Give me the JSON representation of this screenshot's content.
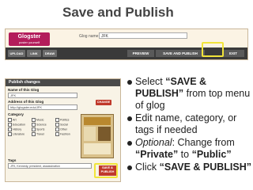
{
  "slide": {
    "title": "Save and Publish"
  },
  "glogster_top": {
    "logo_text": "Glogster",
    "logo_sub": "poster yourself",
    "glog_name_label": "Glog name:",
    "glog_name_value": "JFK",
    "buttons": {
      "upload": "UPLOAD",
      "link": "LINK",
      "draw": "DRAW"
    },
    "preview_label": "PREVIEW",
    "save_publish_label": "SAVE AND PUBLISH",
    "exit_label": "EXIT"
  },
  "publish_panel": {
    "header": "Publish changes",
    "name_label": "Name of this Glog",
    "name_value": "JFK",
    "address_label": "Address of this Glog",
    "address_value": "http://glogster.edu/JFK",
    "change_label": "CHANGE",
    "category_label": "Category",
    "categories": [
      "Art",
      "Education",
      "History",
      "Literature",
      "Music",
      "Science",
      "Sports",
      "Travel",
      "Politics",
      "Social",
      "Other",
      "Fashion"
    ],
    "tags_label": "Tags",
    "tags_value": "JFK, Kennedy, president, assassination",
    "save_btn_line1": "SAVE &",
    "save_btn_line2": "PUBLISH"
  },
  "bullets": [
    {
      "prefix": "Select ",
      "bold": "“SAVE & PUBLISH”",
      "suffix": " from top menu of glog"
    },
    {
      "text": "Edit name, category, or tags if needed"
    },
    {
      "italic": "Optional",
      "mid": ": Change from ",
      "bold1": "“Private”",
      "mid2": " to ",
      "bold2": "“Public”"
    },
    {
      "prefix": "Click ",
      "bold": "“SAVE & PUBLISH”"
    }
  ],
  "colors": {
    "highlight": "#f1e43a",
    "logo": "#b31d5b",
    "toolbar": "#3a3a3a",
    "button_red": "#c0392b"
  }
}
